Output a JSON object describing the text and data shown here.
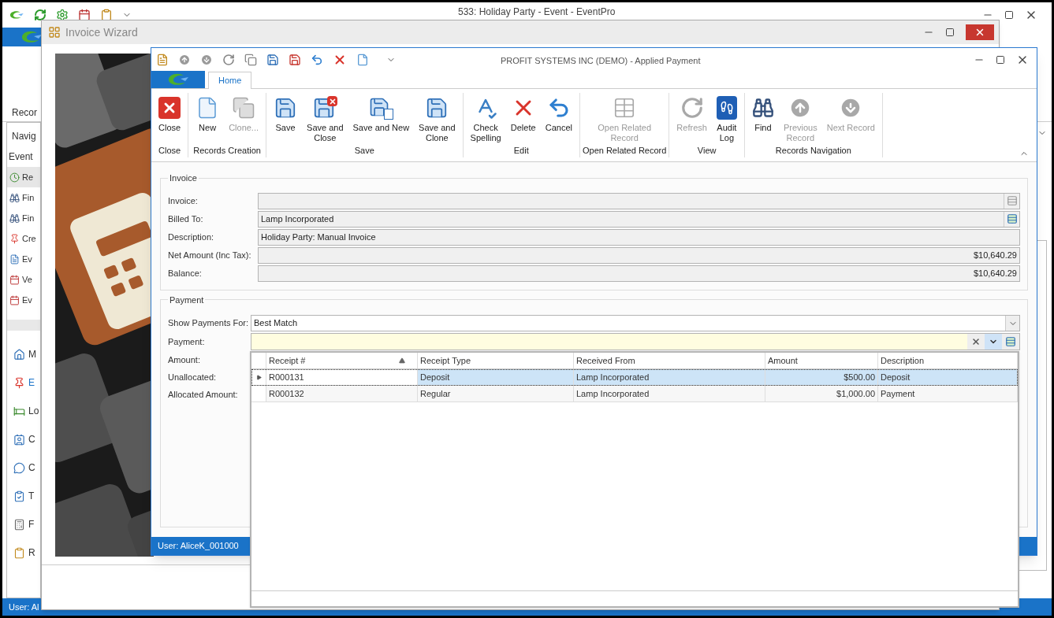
{
  "main_window": {
    "title": "533: Holiday Party - Event - EventPro",
    "ribbon_tab": "Recor",
    "nav_header": "Navig",
    "nav_section": "Event",
    "nav_items": [
      {
        "label": "Re",
        "kind": "clock",
        "selected": true
      },
      {
        "label": "Fin",
        "kind": "find",
        "selected": false
      },
      {
        "label": "Fin",
        "kind": "find",
        "selected": false
      },
      {
        "label": "Cre",
        "kind": "pin",
        "selected": false
      },
      {
        "label": "Ev",
        "kind": "doc",
        "selected": false
      },
      {
        "label": "Ve",
        "kind": "calendar",
        "selected": false
      },
      {
        "label": "Ev",
        "kind": "calendar",
        "selected": false
      }
    ],
    "module_items": [
      {
        "label": "M",
        "kind": "home",
        "selected": false
      },
      {
        "label": "E",
        "kind": "pin",
        "selected": true
      },
      {
        "label": "Lo",
        "kind": "bed",
        "selected": false
      },
      {
        "label": "C",
        "kind": "contact",
        "selected": false
      },
      {
        "label": "C",
        "kind": "chat",
        "selected": false
      },
      {
        "label": "T",
        "kind": "task",
        "selected": false
      },
      {
        "label": "F",
        "kind": "calc",
        "selected": false
      },
      {
        "label": "R",
        "kind": "clipboard",
        "selected": false
      }
    ],
    "status": "User: Al"
  },
  "wizard": {
    "title": "Invoice Wizard"
  },
  "dialog": {
    "title": "PROFIT SYSTEMS INC (DEMO) - Applied Payment",
    "tabs": [
      {
        "label": "Home",
        "selected": true
      }
    ],
    "ribbon_groups": [
      {
        "label": "Close",
        "buttons": [
          {
            "label": "Close",
            "kind": "close",
            "disabled": false
          }
        ]
      },
      {
        "label": "Records Creation",
        "buttons": [
          {
            "label": "New",
            "kind": "new",
            "disabled": false
          },
          {
            "label": "Clone...",
            "kind": "clone",
            "disabled": true
          }
        ]
      },
      {
        "label": "Save",
        "buttons": [
          {
            "label": "Save",
            "kind": "save",
            "disabled": false
          },
          {
            "label": "Save and\nClose",
            "kind": "save-close",
            "disabled": false
          },
          {
            "label": "Save and New",
            "kind": "save-new",
            "disabled": false
          },
          {
            "label": "Save and\nClone",
            "kind": "save",
            "disabled": false
          }
        ]
      },
      {
        "label": "Edit",
        "buttons": [
          {
            "label": "Check\nSpelling",
            "kind": "spell",
            "disabled": false
          },
          {
            "label": "Delete",
            "kind": "delete",
            "disabled": false
          },
          {
            "label": "Cancel",
            "kind": "undo",
            "disabled": false
          }
        ]
      },
      {
        "label": "Open Related Record",
        "buttons": [
          {
            "label": "Open Related\nRecord",
            "kind": "related",
            "disabled": true
          }
        ]
      },
      {
        "label": "View",
        "buttons": [
          {
            "label": "Refresh",
            "kind": "refresh",
            "disabled": true
          },
          {
            "label": "Audit\nLog",
            "kind": "audit",
            "disabled": false
          }
        ]
      },
      {
        "label": "Records Navigation",
        "buttons": [
          {
            "label": "Find",
            "kind": "find",
            "disabled": false
          },
          {
            "label": "Previous\nRecord",
            "kind": "up",
            "disabled": true
          },
          {
            "label": "Next Record",
            "kind": "down",
            "disabled": true
          }
        ]
      }
    ],
    "invoice": {
      "title": "Invoice",
      "fields": [
        {
          "label": "Invoice:",
          "kind": "text",
          "lookup": {
            "disabled": true
          }
        },
        {
          "label": "Billed To:",
          "kind": "text",
          "value": "Lamp Incorporated",
          "lookup": {
            "disabled": false
          }
        },
        {
          "label": "Description:",
          "kind": "text",
          "value": "Holiday Party: Manual Invoice"
        },
        {
          "label": "Net Amount (Inc Tax):",
          "kind": "amount",
          "value": "$10,640.29"
        },
        {
          "label": "Balance:",
          "kind": "amount",
          "value": "$10,640.29"
        }
      ]
    },
    "payment": {
      "title": "Payment",
      "show_for": {
        "label": "Show Payments For:",
        "value": "Best Match"
      },
      "payment_field": {
        "label": "Payment:",
        "focused": true
      },
      "labels": [
        "Amount:",
        "Unallocated:",
        "Allocated Amount:"
      ]
    },
    "status": "User: AliceK_001000"
  },
  "payment_popup": {
    "columns": [
      {
        "label": "Receipt #",
        "kind": "text",
        "sorted": true
      },
      {
        "label": "Receipt Type",
        "kind": "text"
      },
      {
        "label": "Received From",
        "kind": "text"
      },
      {
        "label": "Amount",
        "kind": "amount"
      },
      {
        "label": "Description",
        "kind": "text"
      }
    ],
    "rows": [
      {
        "selected": true,
        "cells": [
          "R000131",
          "Deposit",
          "Lamp Incorporated",
          "$500.00",
          "Deposit"
        ]
      },
      {
        "selected": false,
        "cells": [
          "R000132",
          "Regular",
          "Lamp Incorporated",
          "$1,000.00",
          "Payment"
        ]
      }
    ]
  }
}
